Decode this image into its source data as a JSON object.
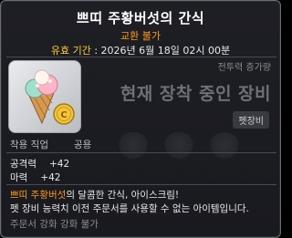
{
  "item": {
    "title": "쁘띠 주황버섯의 간식",
    "trade": "교환 불가",
    "expire_label": "유효 기간",
    "expire_value": " : 2026년 6월 18일 02시 00분",
    "icon": "ice-cream-icon"
  },
  "compare": {
    "power_label": "전투력 증가량",
    "equipped_text": "현재 장착 중인 장비",
    "pet_badge": "펫장비"
  },
  "requirements": {
    "job_label": "착용 직업",
    "job_value": "공용"
  },
  "stats": [
    {
      "label": "공격력",
      "value": "+42"
    },
    {
      "label": "마력",
      "value": "+42"
    }
  ],
  "description": {
    "highlight": "쁘띠 주황버섯",
    "line1_rest": "의 달콤한 간식, 아이스크림!",
    "line2": "펫 장비 능력치 이전 주문서를 사용할 수 없는 아이템입니다."
  },
  "scroll_text": "주문서 강화 강화 불가",
  "colors": {
    "title": "#ffffff",
    "trade": "#ff9a1e",
    "expire_label": "#ffcc33",
    "highlight": "#ff9a1e",
    "muted": "#8b8d93"
  }
}
